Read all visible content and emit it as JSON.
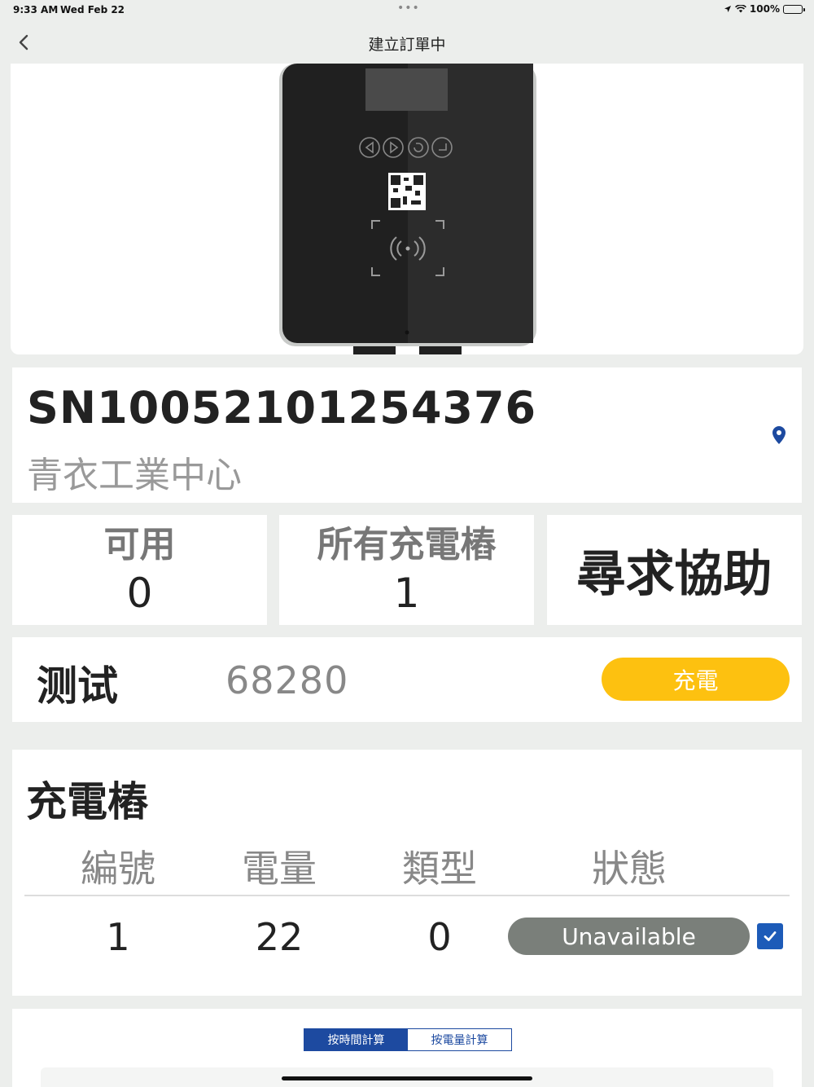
{
  "status_bar": {
    "time": "9:33 AM",
    "date": "Wed Feb 22",
    "battery": "100%"
  },
  "nav": {
    "title": "建立訂單中"
  },
  "station": {
    "serial": "SN10052101254376",
    "location": "青衣工業中心"
  },
  "stats": {
    "available_label": "可用",
    "available_value": "0",
    "all_label": "所有充電樁",
    "all_value": "1",
    "help_label": "尋求協助"
  },
  "action": {
    "name": "测试",
    "number": "68280",
    "charge_label": "充電"
  },
  "chargers": {
    "heading": "充電樁",
    "columns": [
      "編號",
      "電量",
      "類型",
      "狀態"
    ],
    "rows": [
      {
        "id": "1",
        "power": "22",
        "type": "0",
        "status": "Unavailable",
        "checked": true
      }
    ]
  },
  "calc": {
    "tab_time": "按時間計算",
    "tab_energy": "按電量計算"
  },
  "colors": {
    "accent": "#fdc110",
    "primary": "#1d4aa0",
    "status_gray": "#7a7f7a"
  }
}
